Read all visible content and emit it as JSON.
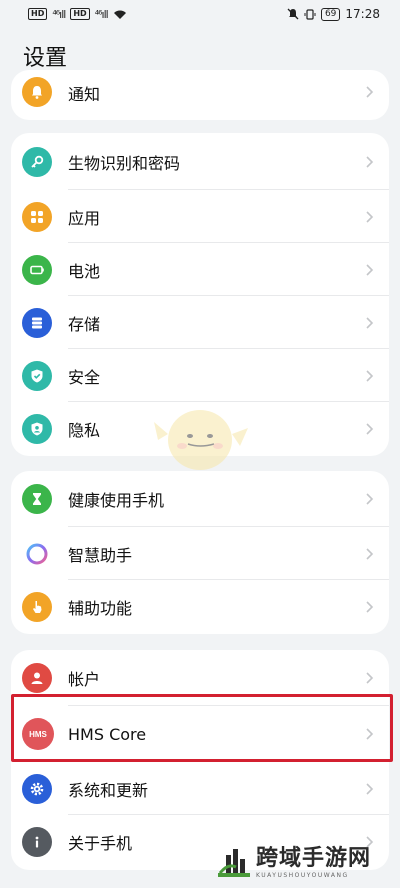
{
  "status_bar": {
    "left_chips": [
      "HD",
      "HD"
    ],
    "network_left": "⁴⁶ıll",
    "network_right": "⁴⁶ıll",
    "battery": "69",
    "time": "17:28"
  },
  "page_title": "设置",
  "groups": [
    {
      "items": [
        {
          "label": "通知",
          "icon": "bell-icon",
          "color": "#f2a427"
        }
      ]
    },
    {
      "items": [
        {
          "label": "生物识别和密码",
          "icon": "key-icon",
          "color": "#2fb9a8"
        },
        {
          "label": "应用",
          "icon": "apps-grid-icon",
          "color": "#f2a427"
        },
        {
          "label": "电池",
          "icon": "battery-icon",
          "color": "#3bb54a"
        },
        {
          "label": "存储",
          "icon": "storage-icon",
          "color": "#2a5fd8"
        },
        {
          "label": "安全",
          "icon": "shield-icon",
          "color": "#2fb9a8"
        },
        {
          "label": "隐私",
          "icon": "privacy-icon",
          "color": "#2fb9a8"
        }
      ]
    },
    {
      "items": [
        {
          "label": "健康使用手机",
          "icon": "hourglass-icon",
          "color": "#3bb54a"
        },
        {
          "label": "智慧助手",
          "icon": "assistant-ring-icon",
          "color": "#8a6cf0"
        },
        {
          "label": "辅助功能",
          "icon": "hand-icon",
          "color": "#f2a427"
        }
      ]
    },
    {
      "items": [
        {
          "label": "帐户",
          "icon": "account-icon",
          "color": "#e04a43"
        },
        {
          "label": "HMS Core",
          "icon": "hms-icon",
          "color": "#e0555a",
          "icon_text": "HMS"
        },
        {
          "label": "系统和更新",
          "icon": "gear-icon",
          "color": "#2a5fd8"
        },
        {
          "label": "关于手机",
          "icon": "info-icon",
          "color": "#555a60"
        }
      ]
    }
  ],
  "watermark": {
    "title": "跨域手游网",
    "subtitle": "KUAYUSHOUYOUWANG"
  }
}
